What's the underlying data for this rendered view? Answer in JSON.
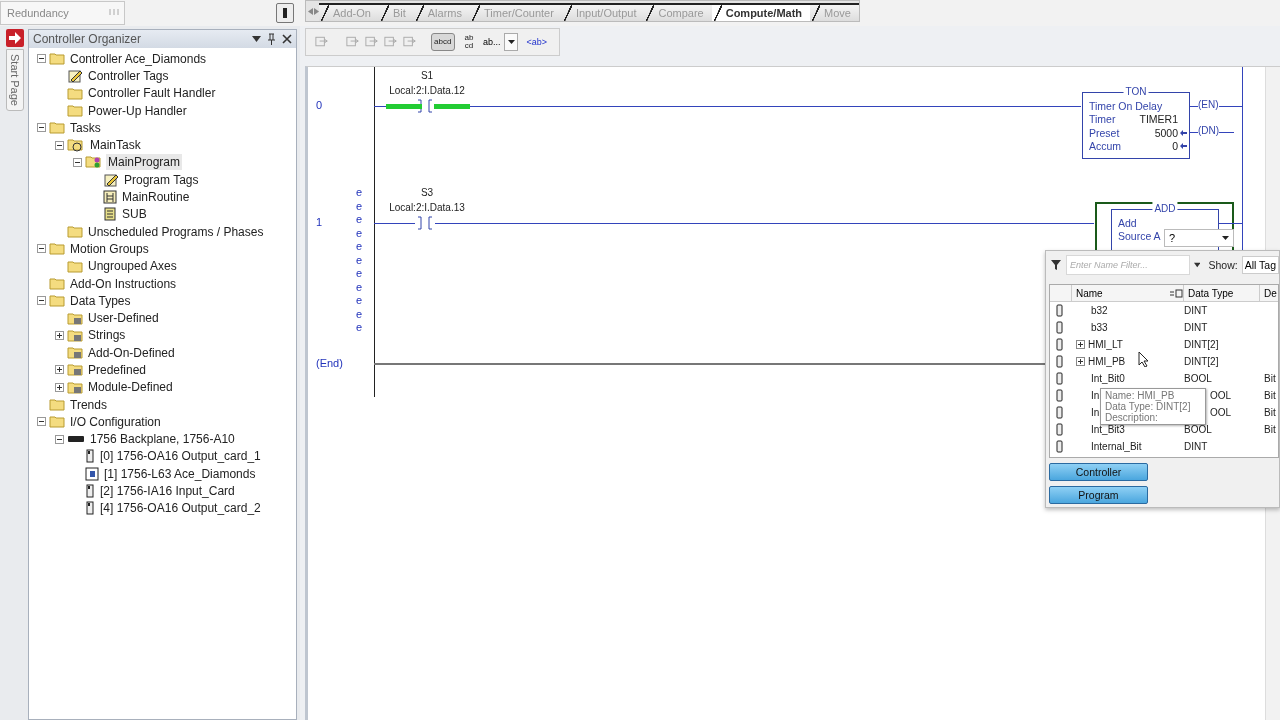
{
  "top_bar": {
    "redundancy": "Redundancy"
  },
  "instruction_tabs": [
    {
      "label": "Add-On",
      "selected": false
    },
    {
      "label": "Bit",
      "selected": false
    },
    {
      "label": "Alarms",
      "selected": false
    },
    {
      "label": "Timer/Counter",
      "selected": false
    },
    {
      "label": "Input/Output",
      "selected": false
    },
    {
      "label": "Compare",
      "selected": false
    },
    {
      "label": "Compute/Math",
      "selected": true
    },
    {
      "label": "Move",
      "selected": false
    }
  ],
  "organizer": {
    "title": "Controller Organizer",
    "start_page": "Start Page",
    "tree": [
      {
        "label": "Controller Ace_Diamonds",
        "kind": "folder",
        "expanded": true,
        "selected": false,
        "children": [
          {
            "label": "Controller Tags",
            "kind": "tags",
            "selected": false
          },
          {
            "label": "Controller Fault Handler",
            "kind": "folder",
            "selected": false
          },
          {
            "label": "Power-Up Handler",
            "kind": "folder",
            "selected": false
          }
        ]
      },
      {
        "label": "Tasks",
        "kind": "folder",
        "expanded": true,
        "selected": false,
        "children": [
          {
            "label": "MainTask",
            "kind": "task",
            "expanded": true,
            "selected": false,
            "children": [
              {
                "label": "MainProgram",
                "kind": "program",
                "expanded": true,
                "selected": true,
                "children": [
                  {
                    "label": "Program Tags",
                    "kind": "tags",
                    "selected": false
                  },
                  {
                    "label": "MainRoutine",
                    "kind": "routine",
                    "selected": false
                  },
                  {
                    "label": "SUB",
                    "kind": "sub",
                    "selected": false
                  }
                ]
              }
            ]
          },
          {
            "label": "Unscheduled Programs / Phases",
            "kind": "folder",
            "selected": false
          }
        ]
      },
      {
        "label": "Motion Groups",
        "kind": "folder",
        "expanded": true,
        "selected": false,
        "children": [
          {
            "label": "Ungrouped Axes",
            "kind": "folder",
            "selected": false
          }
        ]
      },
      {
        "label": "Add-On Instructions",
        "kind": "folder",
        "selected": false
      },
      {
        "label": "Data Types",
        "kind": "folder",
        "expanded": true,
        "selected": false,
        "children": [
          {
            "label": "User-Defined",
            "kind": "types",
            "selected": false
          },
          {
            "label": "Strings",
            "kind": "types",
            "expanded": false,
            "selected": false
          },
          {
            "label": "Add-On-Defined",
            "kind": "types",
            "selected": false
          },
          {
            "label": "Predefined",
            "kind": "types",
            "expanded": false,
            "selected": false
          },
          {
            "label": "Module-Defined",
            "kind": "types",
            "expanded": false,
            "selected": false
          }
        ]
      },
      {
        "label": "Trends",
        "kind": "folder",
        "selected": false
      },
      {
        "label": "I/O Configuration",
        "kind": "folder",
        "expanded": true,
        "selected": false,
        "children": [
          {
            "label": "1756 Backplane, 1756-A10",
            "kind": "backplane",
            "expanded": true,
            "selected": false,
            "children": [
              {
                "label": "[0] 1756-OA16 Output_card_1",
                "kind": "module",
                "selected": false
              },
              {
                "label": "[1] 1756-L63 Ace_Diamonds",
                "kind": "cpu",
                "selected": false
              },
              {
                "label": "[2] 1756-IA16 Input_Card",
                "kind": "module",
                "selected": false
              },
              {
                "label": "[4] 1756-OA16 Output_card_2",
                "kind": "module",
                "selected": false
              }
            ]
          }
        ]
      }
    ]
  },
  "toolbar": [
    {
      "kind": "toggle",
      "label": "abcd",
      "selected": true
    },
    {
      "kind": "stacked",
      "lines": [
        "ab",
        "cd"
      ],
      "selected": false
    },
    {
      "kind": "dropdown",
      "label": "ab..."
    },
    {
      "kind": "link",
      "label": "<ab>"
    }
  ],
  "ladder": {
    "rungs": [
      {
        "number": "0",
        "contact": {
          "name": "S1",
          "address": "Local:2:I.Data.12",
          "energized": true
        },
        "instruction": {
          "kind": "timer",
          "title": "TON",
          "description": "Timer On Delay",
          "params": [
            {
              "name": "Timer",
              "value": "TIMER1",
              "arrow": false
            },
            {
              "name": "Preset",
              "value": "5000",
              "arrow": true
            },
            {
              "name": "Accum",
              "value": "0",
              "arrow": true
            }
          ],
          "outputs": [
            "(EN)",
            "(DN)"
          ]
        }
      },
      {
        "number": "1",
        "markers": [
          "e",
          "e",
          "e",
          "e",
          "e",
          "e",
          "e",
          "e",
          "e",
          "e",
          "e"
        ],
        "contact": {
          "name": "S3",
          "address": "Local:2:I.Data.13",
          "energized": false
        },
        "instruction": {
          "kind": "math",
          "title": "ADD",
          "description": "Add",
          "params": [
            {
              "name": "Source A",
              "value": "?"
            }
          ],
          "selected": true
        }
      }
    ],
    "end": "(End)"
  },
  "tag_browser": {
    "filter_placeholder": "Enter Name Filter...",
    "show_label": "Show:",
    "show_value": "All Tag",
    "columns": [
      "Name",
      "Data Type",
      "De"
    ],
    "rows": [
      {
        "name": "b32",
        "type": "DINT"
      },
      {
        "name": "b33",
        "type": "DINT"
      },
      {
        "name": "HMI_LT",
        "type": "DINT[2]",
        "expanded": false
      },
      {
        "name": "HMI_PB",
        "type": "DINT[2]",
        "expanded": false
      },
      {
        "name": "Int_Bit0",
        "type": "BOOL",
        "description": "Bit"
      },
      {
        "name": "In",
        "type": "OOL",
        "description": "Bit"
      },
      {
        "name": "In",
        "type": "OOL",
        "description": "Bit"
      },
      {
        "name": "Int_Bit3",
        "type": "BOOL",
        "description": "Bit"
      },
      {
        "name": "Internal_Bit",
        "type": "DINT"
      }
    ],
    "tooltip": [
      "Name: HMI_PB",
      "Data Type: DINT[2]",
      "Description:"
    ],
    "buttons": [
      "Controller",
      "Program"
    ]
  }
}
